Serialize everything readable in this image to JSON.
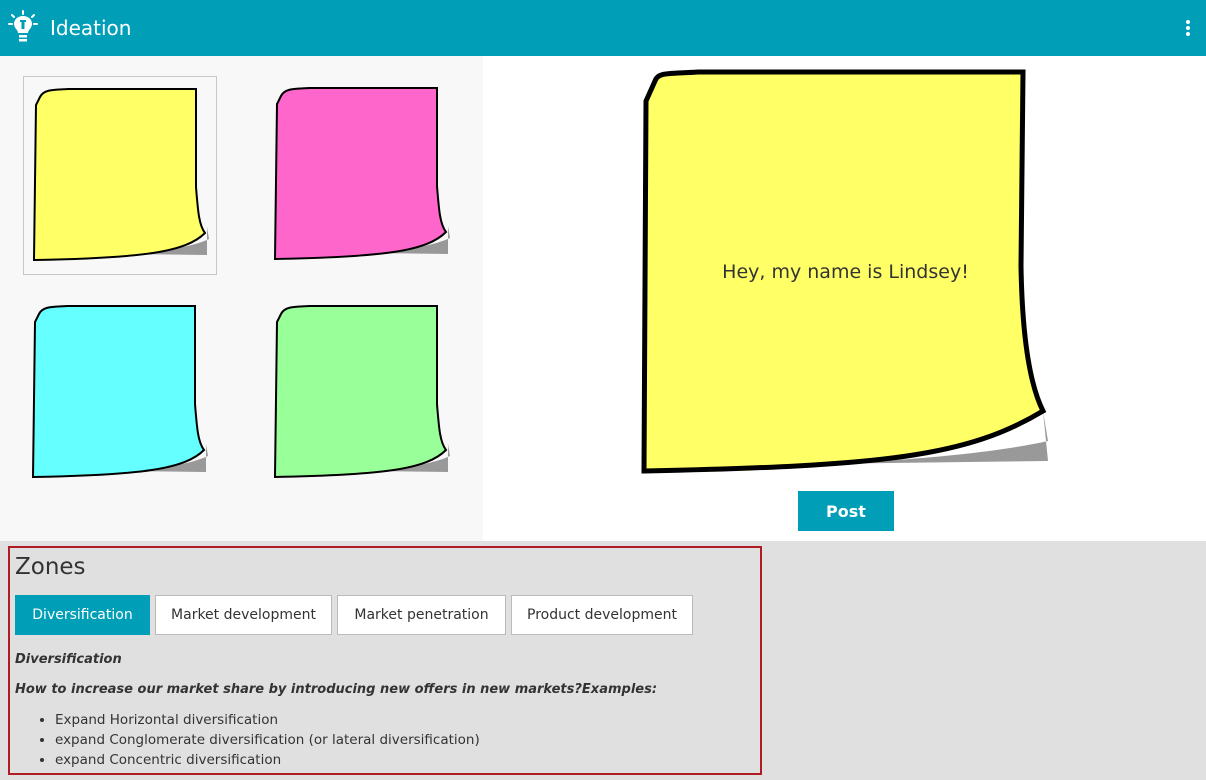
{
  "app": {
    "title": "Ideation",
    "logo_icon": "lightbulb-icon",
    "menu_icon": "kebab-menu-icon",
    "accent_color": "#009fb7"
  },
  "palette": {
    "colors": [
      {
        "name": "yellow",
        "hex": "#ffff66",
        "selected": true
      },
      {
        "name": "pink",
        "hex": "#ff66cc",
        "selected": false
      },
      {
        "name": "cyan",
        "hex": "#66ffff",
        "selected": false
      },
      {
        "name": "green",
        "hex": "#99ff99",
        "selected": false
      }
    ]
  },
  "editor": {
    "note_text": "Hey, my name is Lindsey!",
    "note_color": "#ffff66",
    "post_label": "Post"
  },
  "zones": {
    "title": "Zones",
    "tabs": [
      {
        "label": "Diversification",
        "active": true
      },
      {
        "label": "Market development",
        "active": false
      },
      {
        "label": "Market penetration",
        "active": false
      },
      {
        "label": "Product development",
        "active": false
      }
    ],
    "heading": "Diversification",
    "question": "How to increase our market share by introducing new offers in new markets?Examples:",
    "examples": [
      "Expand Horizontal diversification",
      "expand Conglomerate diversification (or lateral diversification)",
      "expand Concentric diversification"
    ]
  }
}
